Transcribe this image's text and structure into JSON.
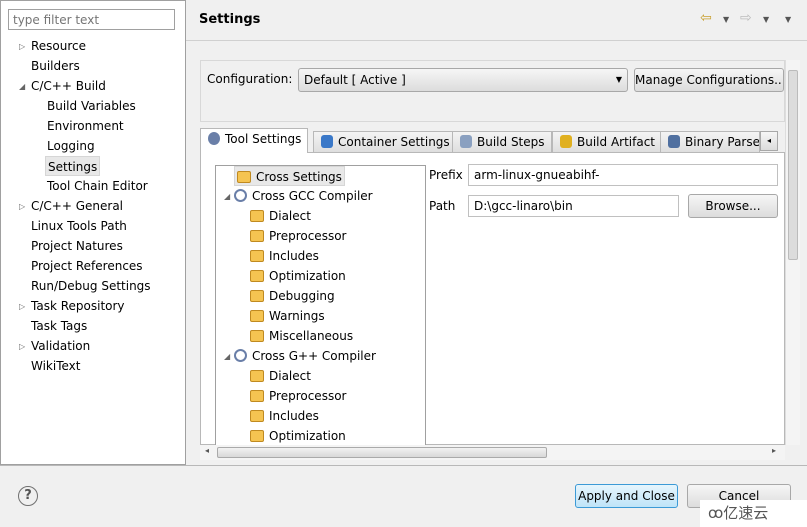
{
  "filter": {
    "placeholder": "type filter text"
  },
  "nav_tree": [
    {
      "label": "Resource",
      "expander": "collapsed",
      "level": 0
    },
    {
      "label": "Builders",
      "level": 0
    },
    {
      "label": "C/C++ Build",
      "expander": "expanded",
      "level": 0
    },
    {
      "label": "Build Variables",
      "level": 1
    },
    {
      "label": "Environment",
      "level": 1
    },
    {
      "label": "Logging",
      "level": 1
    },
    {
      "label": "Settings",
      "level": 1,
      "selected": true
    },
    {
      "label": "Tool Chain Editor",
      "level": 1
    },
    {
      "label": "C/C++ General",
      "expander": "collapsed",
      "level": 0
    },
    {
      "label": "Linux Tools Path",
      "level": 0
    },
    {
      "label": "Project Natures",
      "level": 0
    },
    {
      "label": "Project References",
      "level": 0
    },
    {
      "label": "Run/Debug Settings",
      "level": 0
    },
    {
      "label": "Task Repository",
      "expander": "collapsed",
      "level": 0
    },
    {
      "label": "Task Tags",
      "level": 0
    },
    {
      "label": "Validation",
      "expander": "collapsed",
      "level": 0
    },
    {
      "label": "WikiText",
      "level": 0
    }
  ],
  "header": {
    "title": "Settings"
  },
  "configuration": {
    "label": "Configuration:",
    "value": "Default  [ Active ]",
    "manage_button": "Manage Configurations..."
  },
  "tabs": [
    {
      "label": "Tool Settings",
      "icon": "tool-settings-icon",
      "active": true
    },
    {
      "label": "Container Settings",
      "icon": "container-icon"
    },
    {
      "label": "Build Steps",
      "icon": "build-steps-icon"
    },
    {
      "label": "Build Artifact",
      "icon": "build-artifact-icon"
    },
    {
      "label": "Binary Parse",
      "icon": "binary-parser-icon"
    }
  ],
  "tool_tree": [
    {
      "label": "Cross Settings",
      "icon": "folder",
      "level": 0,
      "selected": true
    },
    {
      "label": "Cross GCC Compiler",
      "icon": "gear",
      "level": 0,
      "expander": "expanded"
    },
    {
      "label": "Dialect",
      "icon": "folder",
      "level": 1
    },
    {
      "label": "Preprocessor",
      "icon": "folder",
      "level": 1
    },
    {
      "label": "Includes",
      "icon": "folder",
      "level": 1
    },
    {
      "label": "Optimization",
      "icon": "folder",
      "level": 1
    },
    {
      "label": "Debugging",
      "icon": "folder",
      "level": 1
    },
    {
      "label": "Warnings",
      "icon": "folder",
      "level": 1
    },
    {
      "label": "Miscellaneous",
      "icon": "folder",
      "level": 1
    },
    {
      "label": "Cross G++ Compiler",
      "icon": "gear",
      "level": 0,
      "expander": "expanded"
    },
    {
      "label": "Dialect",
      "icon": "folder",
      "level": 1
    },
    {
      "label": "Preprocessor",
      "icon": "folder",
      "level": 1
    },
    {
      "label": "Includes",
      "icon": "folder",
      "level": 1
    },
    {
      "label": "Optimization",
      "icon": "folder",
      "level": 1
    }
  ],
  "fields": {
    "prefix_label": "Prefix",
    "prefix_value": "arm-linux-gnueabihf-",
    "path_label": "Path",
    "path_value": "D:\\gcc-linaro\\bin",
    "browse_button": "Browse..."
  },
  "footer": {
    "apply_close": "Apply and Close",
    "cancel": "Cancel",
    "help": "?"
  },
  "watermark": "亿速云"
}
